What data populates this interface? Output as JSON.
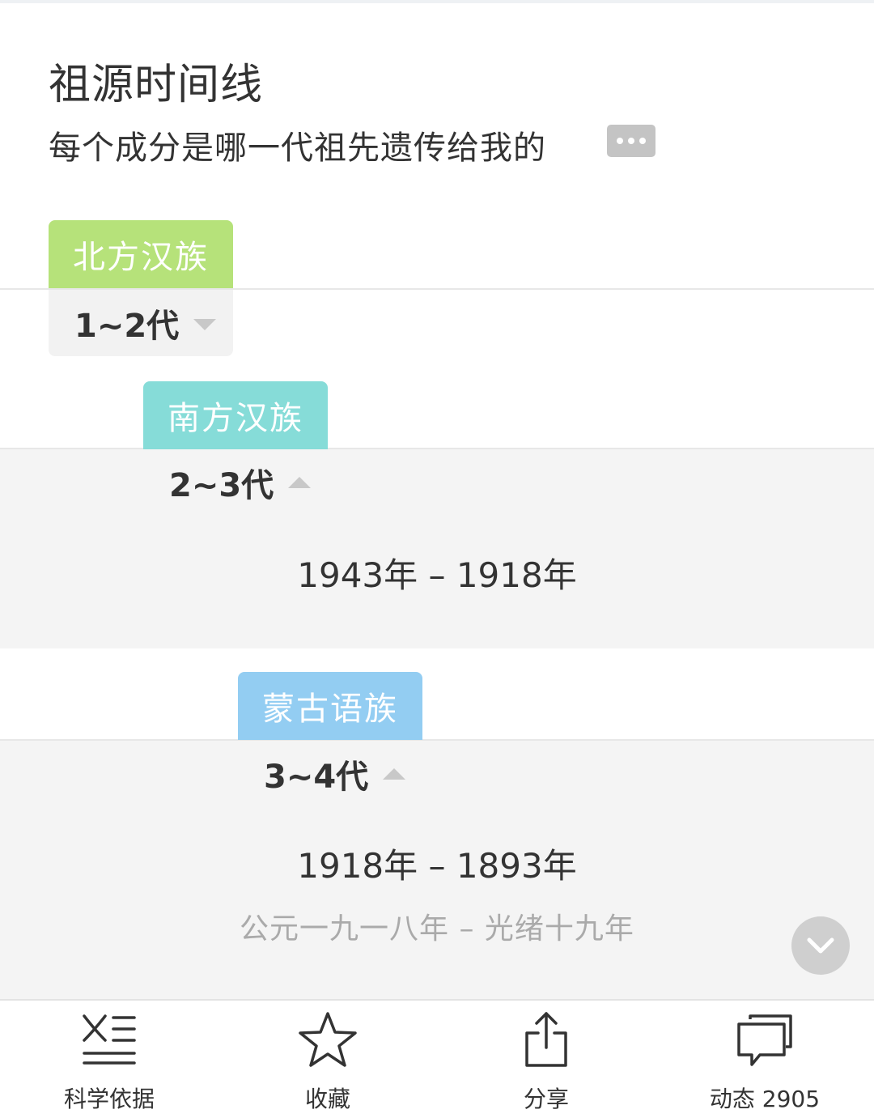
{
  "header": {
    "title": "祖源时间线",
    "subtitle": "每个成分是哪一代祖先遗传给我的"
  },
  "sections": [
    {
      "tag": "北方汉族",
      "tag_color": "#b6e27a",
      "generations": "1~2代",
      "expanded": false
    },
    {
      "tag": "南方汉族",
      "tag_color": "#86dcd8",
      "generations": "2~3代",
      "expanded": true,
      "years": "1943年 – 1918年"
    },
    {
      "tag": "蒙古语族",
      "tag_color": "#93cdf2",
      "generations": "3~4代",
      "expanded": true,
      "years": "1918年 – 1893年",
      "era": "公元一九一八年 – 光绪十九年"
    }
  ],
  "bottom_nav": [
    {
      "label": "科学依据",
      "icon": "dna-icon"
    },
    {
      "label": "收藏",
      "icon": "star-icon"
    },
    {
      "label": "分享",
      "icon": "share-icon"
    },
    {
      "label": "动态 2905",
      "icon": "chat-icon"
    }
  ]
}
